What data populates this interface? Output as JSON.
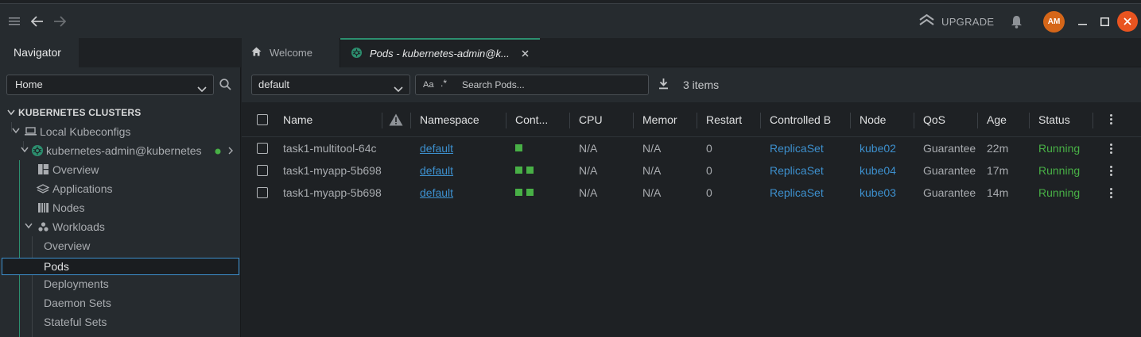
{
  "topbar": {
    "upgrade_label": "UPGRADE",
    "avatar_initials": "AM"
  },
  "navigator": {
    "tab_label": "Navigator",
    "hotbar_select": "Home",
    "section_title": "KUBERNETES CLUSTERS",
    "local_kubeconfigs": "Local Kubeconfigs",
    "cluster_name": "kubernetes-admin@kubernetes",
    "items": {
      "overview": "Overview",
      "applications": "Applications",
      "nodes": "Nodes",
      "workloads": "Workloads",
      "wl_overview": "Overview",
      "pods": "Pods",
      "deployments": "Deployments",
      "daemon_sets": "Daemon Sets",
      "stateful_sets": "Stateful Sets"
    }
  },
  "tabs": {
    "welcome": "Welcome",
    "pods": "Pods - kubernetes-admin@k..."
  },
  "filter": {
    "namespace": "default",
    "search_placeholder": "Search Pods...",
    "case_toggle": "Aa",
    "regex_toggle": ".*",
    "items_count": "3 items"
  },
  "table": {
    "headers": {
      "name": "Name",
      "namespace": "Namespace",
      "containers": "Cont...",
      "cpu": "CPU",
      "memory": "Memor",
      "restarts": "Restart",
      "controlled_by": "Controlled B",
      "node": "Node",
      "qos": "QoS",
      "age": "Age",
      "status": "Status"
    },
    "rows": [
      {
        "name": "task1-multitool-64c",
        "namespace": "default",
        "containers": 1,
        "cpu": "N/A",
        "memory": "N/A",
        "restarts": "0",
        "controlled_by": "ReplicaSet",
        "node": "kube02",
        "qos": "Guarantee",
        "age": "22m",
        "status": "Running"
      },
      {
        "name": "task1-myapp-5b698",
        "namespace": "default",
        "containers": 2,
        "cpu": "N/A",
        "memory": "N/A",
        "restarts": "0",
        "controlled_by": "ReplicaSet",
        "node": "kube04",
        "qos": "Guarantee",
        "age": "17m",
        "status": "Running"
      },
      {
        "name": "task1-myapp-5b698",
        "namespace": "default",
        "containers": 2,
        "cpu": "N/A",
        "memory": "N/A",
        "restarts": "0",
        "controlled_by": "ReplicaSet",
        "node": "kube03",
        "qos": "Guarantee",
        "age": "14m",
        "status": "Running"
      }
    ]
  },
  "colors": {
    "accent": "#3d90ce",
    "running": "#48b046",
    "teal": "#2c8f6f",
    "avatar": "#d56619",
    "close": "#e95420"
  }
}
